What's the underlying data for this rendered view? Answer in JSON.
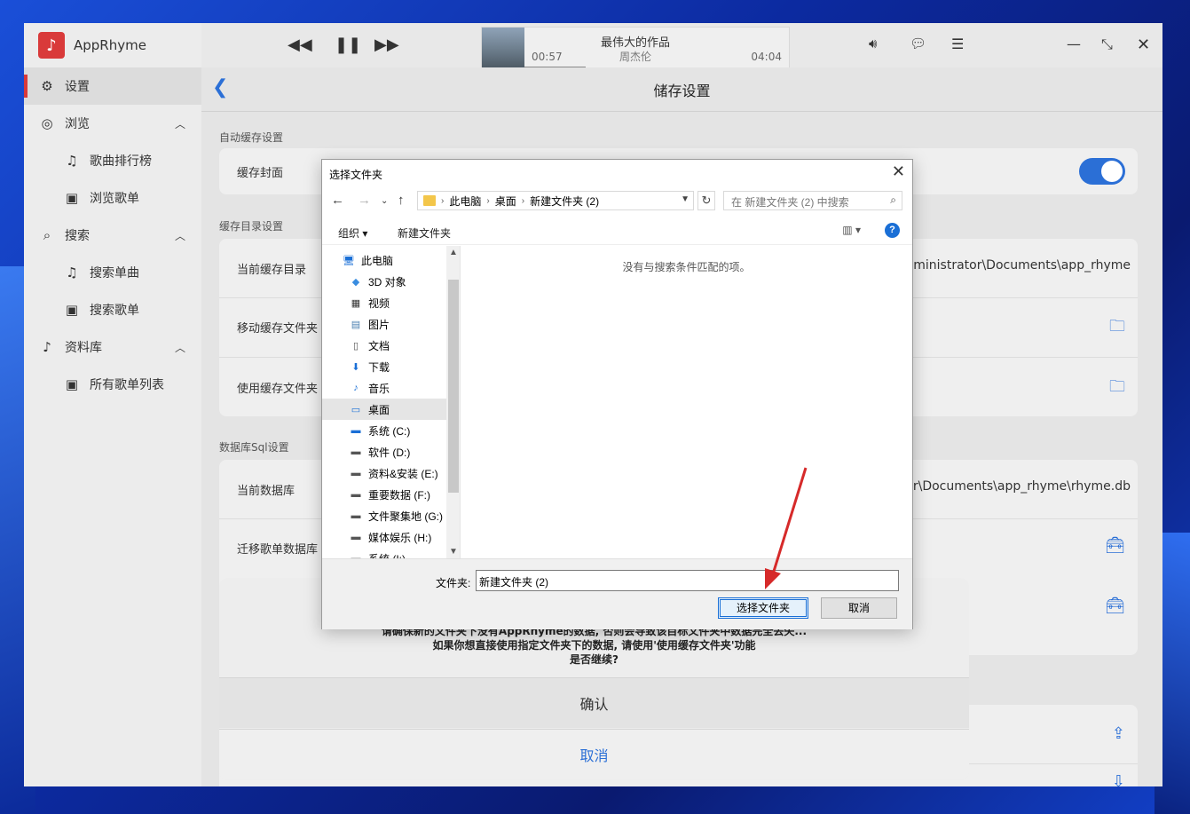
{
  "app": {
    "name": "AppRhyme"
  },
  "sidebar": {
    "items": [
      {
        "label": "设置",
        "icon": "gear-icon"
      },
      {
        "label": "浏览",
        "icon": "compass-icon"
      },
      {
        "label": "歌曲排行榜",
        "icon": "music-note-icon"
      },
      {
        "label": "浏览歌单",
        "icon": "playlist-icon"
      },
      {
        "label": "搜索",
        "icon": "search-icon"
      },
      {
        "label": "搜索单曲",
        "icon": "music-note-icon"
      },
      {
        "label": "搜索歌单",
        "icon": "playlist-icon"
      },
      {
        "label": "资料库",
        "icon": "music-note-icon"
      },
      {
        "label": "所有歌单列表",
        "icon": "playlist-icon"
      }
    ]
  },
  "player": {
    "title": "最伟大的作品",
    "artist": "周杰伦",
    "elapsed": "00:57",
    "duration": "04:04",
    "progress": 0.23
  },
  "page": {
    "title": "储存设置",
    "sections": {
      "auto_cache": "自动缓存设置",
      "cache_dir": "缓存目录设置",
      "db": "数据库Sql设置"
    },
    "rows": {
      "cache_cover": "缓存封面",
      "current_cache_dir": "当前缓存目录",
      "current_cache_dir_value": "dministrator\\Documents\\app_rhyme",
      "move_cache_folder": "移动缓存文件夹",
      "use_cache_folder": "使用缓存文件夹",
      "current_db": "当前数据库",
      "current_db_value": "or\\Documents\\app_rhyme\\rhyme.db",
      "migrate_db": "迁移歌单数据库"
    }
  },
  "sheet": {
    "line1": "请确保新的文件夹下没有AppRhyme的数据, 否则会导致该目标文件夹中数据完全丢失...",
    "line2": "如果你想直接使用指定文件夹下的数据, 请使用'使用缓存文件夹'功能",
    "line3": "是否继续?",
    "confirm": "确认",
    "cancel": "取消"
  },
  "dialog": {
    "title": "选择文件夹",
    "breadcrumb": [
      "此电脑",
      "桌面",
      "新建文件夹 (2)"
    ],
    "search_placeholder": "在 新建文件夹 (2) 中搜索",
    "organize": "组织 ▾",
    "new_folder": "新建文件夹",
    "empty_message": "没有与搜索条件匹配的项。",
    "tree": [
      {
        "label": "此电脑",
        "icon": "computer-icon"
      },
      {
        "label": "3D 对象",
        "icon": "cube-icon"
      },
      {
        "label": "视频",
        "icon": "video-icon"
      },
      {
        "label": "图片",
        "icon": "picture-icon"
      },
      {
        "label": "文档",
        "icon": "document-icon"
      },
      {
        "label": "下载",
        "icon": "download-icon"
      },
      {
        "label": "音乐",
        "icon": "music-note-icon"
      },
      {
        "label": "桌面",
        "icon": "desktop-icon"
      },
      {
        "label": "系统 (C:)",
        "icon": "drive-icon"
      },
      {
        "label": "软件 (D:)",
        "icon": "drive-icon"
      },
      {
        "label": "资料&安装 (E:)",
        "icon": "drive-icon"
      },
      {
        "label": "重要数据 (F:)",
        "icon": "drive-icon"
      },
      {
        "label": "文件聚集地 (G:)",
        "icon": "drive-icon"
      },
      {
        "label": "媒体娱乐 (H:)",
        "icon": "drive-icon"
      },
      {
        "label": "系统 (I:)",
        "icon": "drive-icon"
      }
    ],
    "folder_label": "文件夹:",
    "folder_value": "新建文件夹 (2)",
    "select_button": "选择文件夹",
    "cancel_button": "取消"
  },
  "colors": {
    "accent": "#2b6fd6",
    "brand": "#d93a3a",
    "arrow": "#d62a2a"
  }
}
